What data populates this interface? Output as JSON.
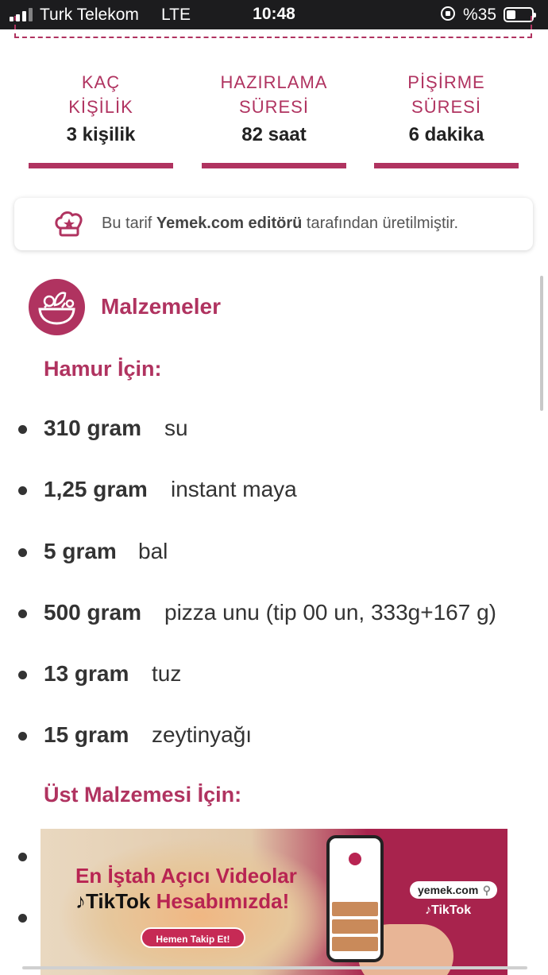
{
  "status_bar": {
    "carrier": "Turk Telekom",
    "network": "LTE",
    "time": "10:48",
    "battery_percent": "%35",
    "battery_level": 0.35
  },
  "stats": [
    {
      "label_line1": "KAÇ",
      "label_line2": "KİŞİLİK",
      "value": "3 kişilik"
    },
    {
      "label_line1": "HAZIRLAMA",
      "label_line2": "SÜRESİ",
      "value": "82 saat"
    },
    {
      "label_line1": "PİŞİRME",
      "label_line2": "SÜRESİ",
      "value": "6 dakika"
    }
  ],
  "notice": {
    "before": "Bu tarif ",
    "bold": "Yemek.com editörü",
    "after": " tarafından üretilmiştir."
  },
  "ingredients": {
    "title": "Malzemeler",
    "section1": "Hamur İçin:",
    "items1": [
      {
        "qty": "310 gram",
        "name": "su"
      },
      {
        "qty": "1,25 gram",
        "name": "instant maya"
      },
      {
        "qty": "5 gram",
        "name": "bal"
      },
      {
        "qty": "500 gram",
        "name": "pizza unu (tip 00 un, 333g+167 g)"
      },
      {
        "qty": "13 gram",
        "name": "tuz"
      },
      {
        "qty": "15 gram",
        "name": "zeytinyağı"
      }
    ],
    "section2": "Üst Malzemesi İçin:"
  },
  "ad": {
    "line1": "En İştah Açıcı Videolar",
    "tiktok": "TikTok",
    "line2_rest": "Hesabımızda!",
    "button": "Hemen Takip Et!",
    "site": "yemek.com",
    "tiktok_brand": "TikTok"
  },
  "colors": {
    "accent": "#b03360",
    "status_bar": "#1c1c1e",
    "text": "#333333"
  },
  "icons": [
    "signal-icon",
    "lock-rotation-icon",
    "battery-icon",
    "chef-hat-icon",
    "salad-bowl-icon",
    "tiktok-icon",
    "search-icon"
  ]
}
